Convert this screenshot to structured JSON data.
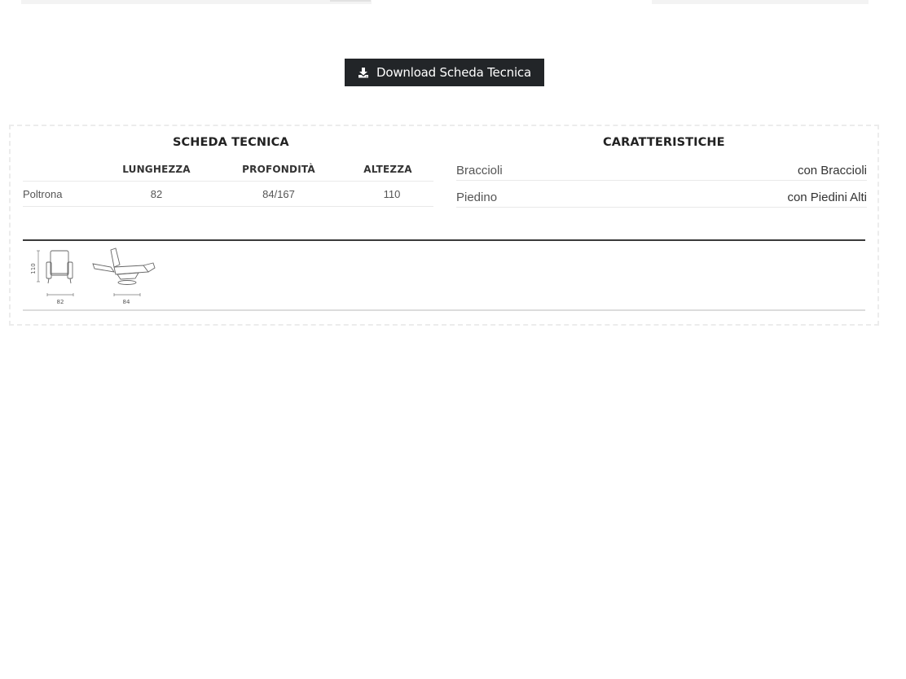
{
  "download": {
    "label": "Download Scheda Tecnica",
    "icon": "download-icon"
  },
  "technical_sheet": {
    "title": "SCHEDA TECNICA",
    "columns": [
      "LUNGHEZZA",
      "PROFONDITÀ",
      "ALTEZZA"
    ],
    "rows": [
      {
        "name": "Poltrona",
        "length": "82",
        "depth": "84/167",
        "height": "110"
      }
    ]
  },
  "features": {
    "title": "CARATTERISTICHE",
    "rows": [
      {
        "label": "Braccioli",
        "value": "con Braccioli"
      },
      {
        "label": "Piedino",
        "value": "con Piedini Alti"
      }
    ]
  },
  "dimension_drawing": {
    "height_label": "110",
    "width_label": "82",
    "depth_label": "84"
  },
  "colors": {
    "button_background": "#222528",
    "button_text": "#ffffff",
    "rule_dark": "#3a3a3a",
    "rule_light": "#dcdcdc"
  }
}
